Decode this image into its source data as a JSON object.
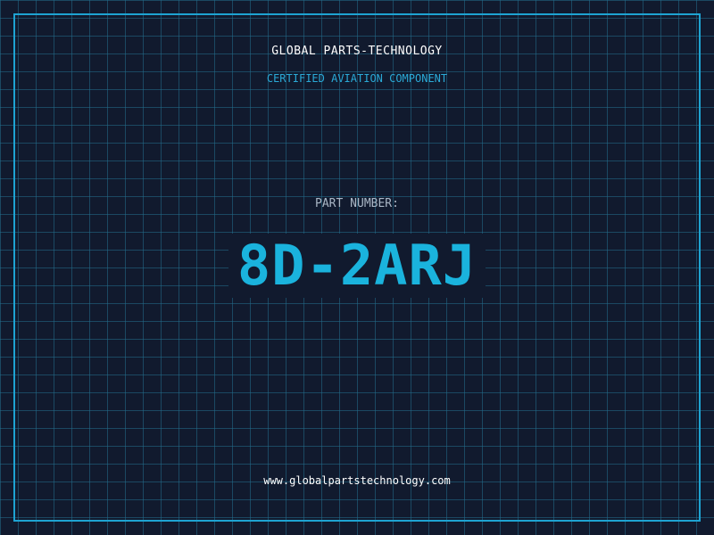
{
  "header": {
    "company": "GLOBAL PARTS-TECHNOLOGY",
    "subtitle": "CERTIFIED AVIATION COMPONENT"
  },
  "part": {
    "label": "PART NUMBER:",
    "number": "8D-2ARJ"
  },
  "footer": {
    "url": "www.globalpartstechnology.com"
  },
  "colors": {
    "background": "#111a2e",
    "grid": "#236e8c",
    "accent": "#1ab3dd",
    "frame": "#1ea3d2",
    "label": "#aab7c6",
    "text": "#ffffff"
  }
}
